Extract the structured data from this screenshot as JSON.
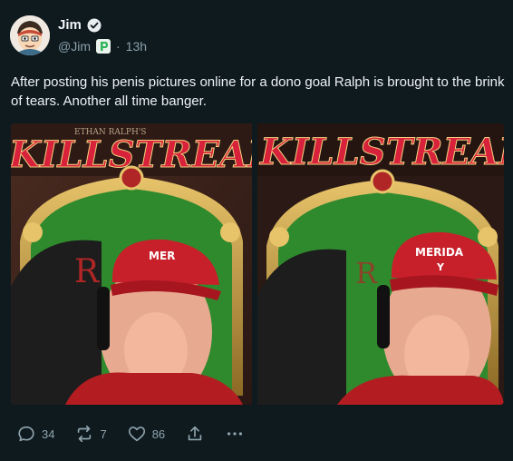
{
  "author": {
    "display_name": "Jim",
    "handle": "@Jim",
    "separator": "·",
    "time": "13h"
  },
  "post": {
    "text": "After posting his penis pictures online for a dono goal Ralph is brought to the brink of tears.  Another all time banger."
  },
  "media": {
    "left_frame_heading": "ETHAN RALPH'S",
    "left_frame_logo": "KILLSTREAM",
    "right_frame_logo": "KILLSTREAM",
    "left_cap_text": "MER",
    "right_cap_text": "MERIDA",
    "right_cap_symbol": "Y",
    "chair_letter": "R"
  },
  "actions": {
    "reply_count": "34",
    "repost_count": "7",
    "like_count": "86"
  },
  "colors": {
    "background": "#0f1a1f",
    "verified": "#e9eef0",
    "badge": "#2fb45a",
    "muted": "#8aa0aa"
  },
  "icons": [
    "verified-icon",
    "platform-badge-icon",
    "reply-icon",
    "repost-icon",
    "like-icon",
    "share-icon",
    "more-icon"
  ]
}
